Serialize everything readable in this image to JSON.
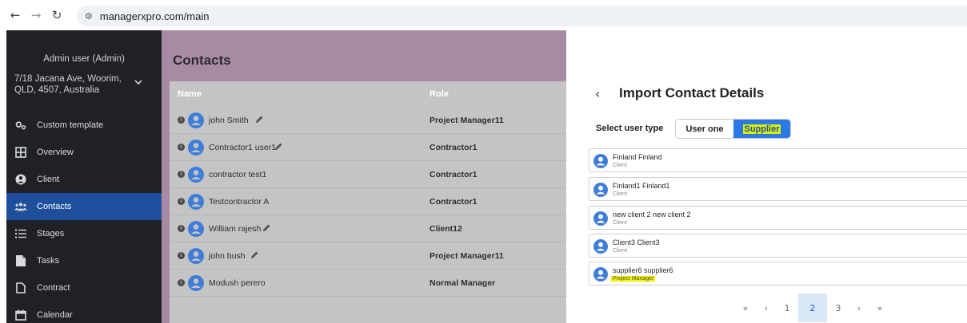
{
  "browser": {
    "url": "managerxpro.com/main"
  },
  "sidebar": {
    "user": "Admin user (Admin)",
    "address": "7/18 Jacana Ave, Woorim, QLD, 4507, Australia",
    "items": [
      {
        "label": "Custom template",
        "icon": "cogs-icon"
      },
      {
        "label": "Overview",
        "icon": "grid-icon"
      },
      {
        "label": "Client",
        "icon": "user-circle-icon"
      },
      {
        "label": "Contacts",
        "icon": "users-icon",
        "active": true
      },
      {
        "label": "Stages",
        "icon": "list-icon"
      },
      {
        "label": "Tasks",
        "icon": "file-icon"
      },
      {
        "label": "Contract",
        "icon": "document-icon"
      },
      {
        "label": "Calendar",
        "icon": "calendar-icon"
      }
    ]
  },
  "contacts": {
    "title": "Contacts",
    "columns": {
      "name": "Name",
      "role": "Role"
    },
    "rows": [
      {
        "name": "john Smith",
        "role": "Project Manager11",
        "editable": true
      },
      {
        "name": "Contractor1 user1",
        "role": "Contractor1",
        "editable": true
      },
      {
        "name": "contractor test1",
        "role": "Contractor1",
        "editable": false
      },
      {
        "name": "Testcontractor A",
        "role": "Contractor1",
        "editable": false
      },
      {
        "name": "William rajesh",
        "role": "Client12",
        "editable": true
      },
      {
        "name": "john bush",
        "role": "Project Manager11",
        "editable": true
      },
      {
        "name": "Modush perero",
        "role": "Normal Manager",
        "editable": false
      }
    ]
  },
  "import": {
    "back": "‹",
    "title": "Import Contact Details",
    "select_label": "Select user type",
    "options": [
      "User one",
      "Supplier"
    ],
    "selected_option": "Supplier",
    "contacts": [
      {
        "name": "Finland Finland",
        "type": "Client"
      },
      {
        "name": "Finland1 Finland1",
        "type": "Client"
      },
      {
        "name": "new client 2 new client 2",
        "type": "Client"
      },
      {
        "name": "Client3 Client3",
        "type": "Client"
      },
      {
        "name": "supplier6 supplier6",
        "type": "Project Manager",
        "highlight": true
      }
    ],
    "pagination": {
      "first": "«",
      "prev": "‹",
      "pages": [
        "1",
        "2",
        "3"
      ],
      "current": "2",
      "next": "›",
      "last": "»"
    }
  },
  "colors": {
    "sidebar_bg": "#1f2127",
    "active_item": "#1d4f9c",
    "overlay": "#a88aa4",
    "accent": "#2979e6",
    "highlight": "#f4f000"
  }
}
